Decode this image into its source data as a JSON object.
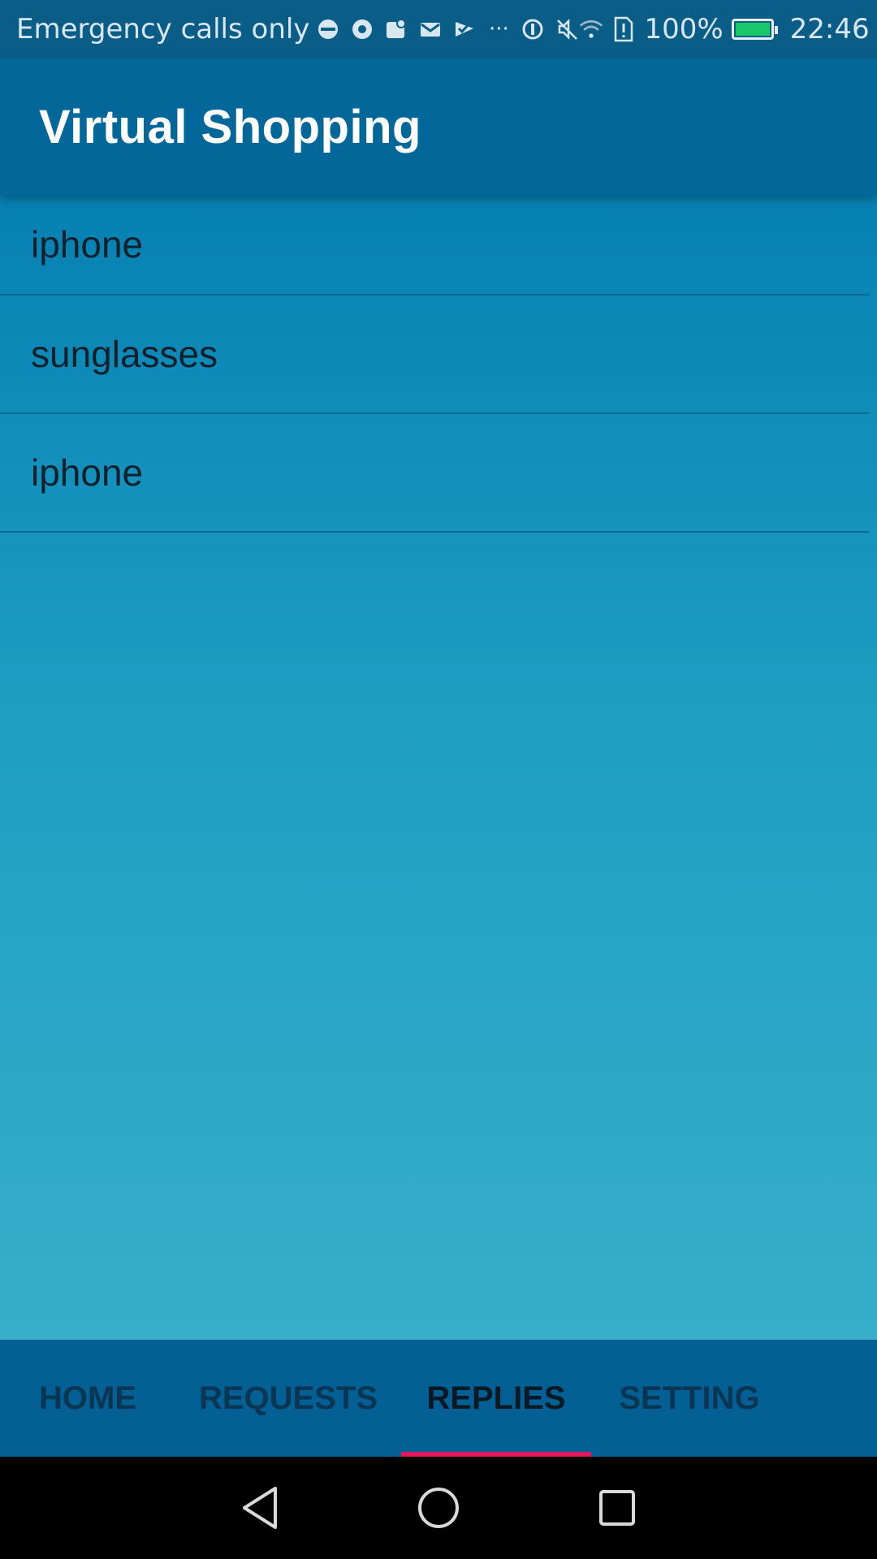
{
  "status_bar": {
    "carrier": "Emergency calls only",
    "icons": [
      "notification-icon",
      "chrome-icon",
      "maps-icon",
      "gmail-icon",
      "check-icon",
      "more-icon",
      "data-saver-icon",
      "mute-icon",
      "wifi-icon",
      "sim-alert-icon"
    ],
    "more_glyph": "···",
    "battery_percent": "100%",
    "battery_level": 1.0,
    "time": "22:46"
  },
  "app_bar": {
    "title": "Virtual Shopping"
  },
  "list": {
    "items": [
      {
        "label": "iphone"
      },
      {
        "label": "sunglasses"
      },
      {
        "label": "iphone"
      }
    ]
  },
  "tabs": [
    {
      "label": "HOME",
      "active": false
    },
    {
      "label": "REQUESTS",
      "active": false
    },
    {
      "label": "REPLIES",
      "active": true
    },
    {
      "label": "SETTING",
      "active": false
    }
  ],
  "colors": {
    "status_bar": "#0a5d86",
    "app_bar": "#03679a",
    "content_top": "#0780b2",
    "content_bottom": "#38aec9",
    "bottom_nav": "#035f94",
    "tab_indicator": "#e0195d",
    "battery_fill": "#19c76a"
  }
}
